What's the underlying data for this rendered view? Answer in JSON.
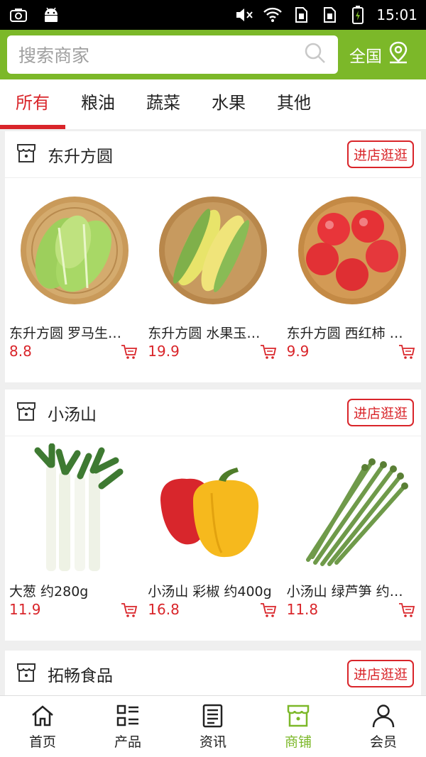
{
  "status_bar": {
    "time": "15:01"
  },
  "search": {
    "placeholder": "搜索商家"
  },
  "region": {
    "label": "全国"
  },
  "tabs": [
    {
      "label": "所有",
      "active": true
    },
    {
      "label": "粮油",
      "active": false
    },
    {
      "label": "蔬菜",
      "active": false
    },
    {
      "label": "水果",
      "active": false
    },
    {
      "label": "其他",
      "active": false
    }
  ],
  "shops": [
    {
      "name": "东升方圆",
      "enter_label": "进店逛逛",
      "products": [
        {
          "name": "东升方圆 罗马生…",
          "price": "8.8",
          "image": "lettuce"
        },
        {
          "name": "东升方圆 水果玉…",
          "price": "19.9",
          "image": "corn"
        },
        {
          "name": "东升方圆 西红柿 …",
          "price": "9.9",
          "image": "tomato"
        }
      ]
    },
    {
      "name": "小汤山",
      "enter_label": "进店逛逛",
      "products": [
        {
          "name": "大葱 约280g",
          "price": "11.9",
          "image": "leek"
        },
        {
          "name": "小汤山 彩椒 约400g",
          "price": "16.8",
          "image": "pepper"
        },
        {
          "name": "小汤山 绿芦笋 约…",
          "price": "11.8",
          "image": "asparagus"
        }
      ]
    },
    {
      "name": "拓畅食品",
      "enter_label": "进店逛逛",
      "products": []
    }
  ],
  "bottom_nav": [
    {
      "label": "首页",
      "icon": "home-icon",
      "active": false
    },
    {
      "label": "产品",
      "icon": "list-icon",
      "active": false
    },
    {
      "label": "资讯",
      "icon": "news-icon",
      "active": false
    },
    {
      "label": "商铺",
      "icon": "store-icon",
      "active": true
    },
    {
      "label": "会员",
      "icon": "user-icon",
      "active": false
    }
  ],
  "colors": {
    "brand_green": "#7cb829",
    "accent_red": "#d9252a"
  }
}
